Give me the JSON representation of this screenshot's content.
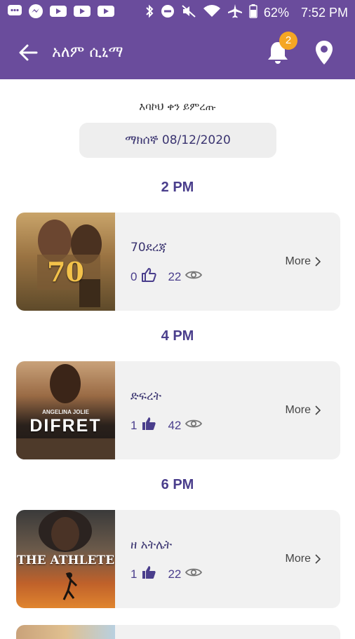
{
  "status_bar": {
    "battery": "62%",
    "time": "7:52 PM"
  },
  "app_bar": {
    "title": "አለም ሲኒማ",
    "notification_count": "2"
  },
  "date_picker": {
    "prompt": "እባኮህ ቀን ይምረጡ",
    "selected_date": "ማክሰኞ 08/12/2020"
  },
  "showtimes": [
    {
      "time": "2 PM",
      "movie": {
        "title": "70ደረጃ",
        "poster_text": "70",
        "likes": "0",
        "views": "22",
        "more_label": "More"
      }
    },
    {
      "time": "4 PM",
      "movie": {
        "title": "ድፍረት",
        "poster_text": "DIFRET",
        "poster_credit": "ANGELINA JOLIE",
        "likes": "1",
        "views": "42",
        "more_label": "More"
      }
    },
    {
      "time": "6 PM",
      "movie": {
        "title": "ዘ አትሌት",
        "poster_text": "THE ATHLETE",
        "likes": "1",
        "views": "22",
        "more_label": "More"
      }
    }
  ],
  "colors": {
    "primary": "#6a4c9c",
    "accent": "#4a3e8c",
    "badge": "#f5a623",
    "card_bg": "#f1f1f1"
  }
}
